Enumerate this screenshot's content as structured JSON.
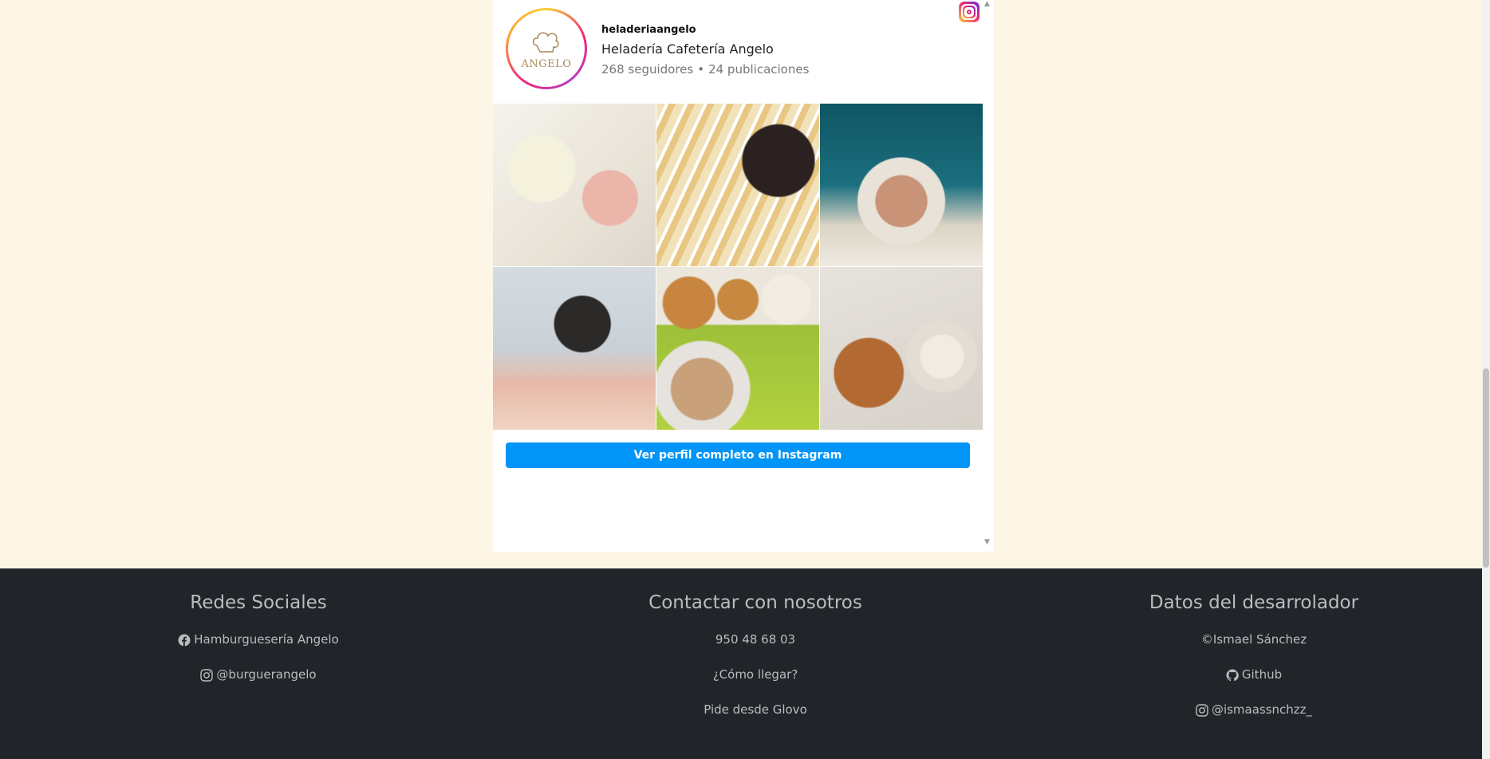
{
  "instagram_widget": {
    "username": "heladeriaangelo",
    "full_name": "Heladería Cafetería Angelo",
    "followers": "268 seguidores",
    "separator": "•",
    "posts": "24 publicaciones",
    "avatar_text": "ANGELO",
    "button_label": "Ver perfil completo en Instagram",
    "scroll_up": "▲",
    "scroll_down": "▼",
    "photos": [
      {
        "subject": "drinks-in-cups"
      },
      {
        "subject": "crepe-with-oreo"
      },
      {
        "subject": "latte-art-coffee"
      },
      {
        "subject": "coffee-cup-and-toast"
      },
      {
        "subject": "croissants-and-coffee"
      },
      {
        "subject": "croissant-and-coffee-cup"
      }
    ]
  },
  "footer": {
    "social": {
      "title": "Redes Sociales",
      "items": [
        {
          "icon": "facebook-icon",
          "label": "Hamburguesería Angelo"
        },
        {
          "icon": "instagram-icon",
          "label": "@burguerangelo"
        }
      ]
    },
    "contact": {
      "title": "Contactar con nosotros",
      "items": [
        {
          "label": "950 48 68 03"
        },
        {
          "label": "¿Cómo llegar?"
        },
        {
          "label": "Pide desde Glovo"
        }
      ]
    },
    "developer": {
      "title": "Datos del desarrolador",
      "items": [
        {
          "label": "©Ismael Sánchez"
        },
        {
          "icon": "github-icon",
          "label": "Github"
        },
        {
          "icon": "instagram-icon",
          "label": "@ismaassnchzz_"
        }
      ]
    }
  },
  "colors": {
    "page_background": "#fdf6e6",
    "footer_background": "#212529",
    "instagram_button": "#0095f6"
  }
}
